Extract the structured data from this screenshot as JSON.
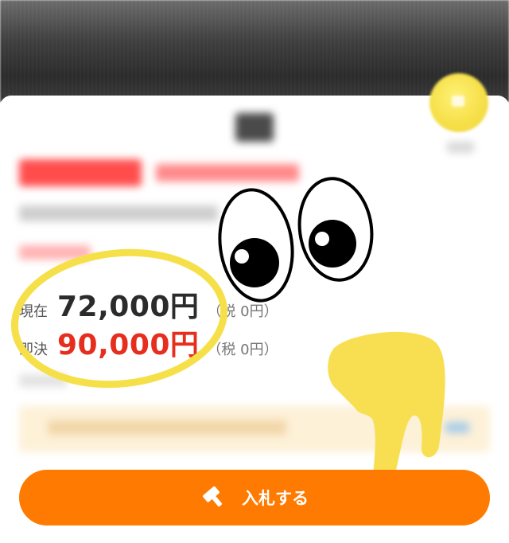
{
  "price": {
    "current_label": "現在",
    "current_value": "72,000円",
    "current_tax": "（税 0円）",
    "buynow_label": "即決",
    "buynow_value": "90,000円",
    "buynow_tax": "（税 0円）"
  },
  "action": {
    "bid_label": "入札する"
  },
  "colors": {
    "accent": "#ff7a00",
    "buynow_red": "#e62e1f",
    "annotation_yellow": "#f6e04a"
  },
  "icons": {
    "bid_icon": "gavel-icon"
  }
}
